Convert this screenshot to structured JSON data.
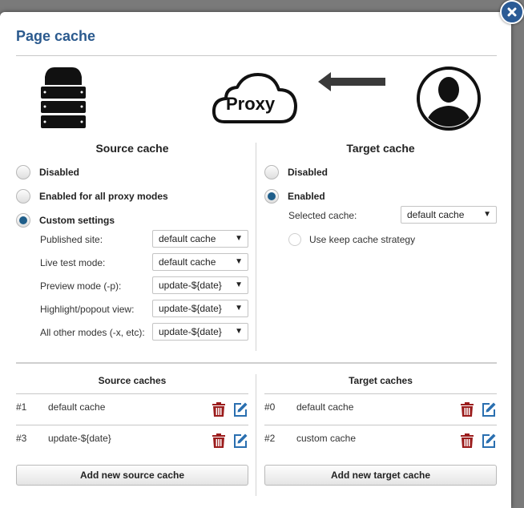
{
  "dialog": {
    "title": "Page cache"
  },
  "diagram": {
    "proxy_label": "Proxy"
  },
  "source": {
    "title": "Source cache",
    "options": [
      "Disabled",
      "Enabled for all proxy modes",
      "Custom settings"
    ],
    "selected": "Custom settings",
    "fields": [
      {
        "label": "Published site:",
        "value": "default cache"
      },
      {
        "label": "Live test mode:",
        "value": "default cache"
      },
      {
        "label": "Preview mode (-p):",
        "value": "update-${date}"
      },
      {
        "label": "Highlight/popout view:",
        "value": "update-${date}"
      },
      {
        "label": "All other modes (-x, etc):",
        "value": "update-${date}"
      }
    ]
  },
  "target": {
    "title": "Target cache",
    "options": [
      "Disabled",
      "Enabled"
    ],
    "selected": "Enabled",
    "selected_cache_label": "Selected cache:",
    "selected_cache_value": "default cache",
    "keep_strategy_label": "Use keep cache strategy"
  },
  "source_caches": {
    "title": "Source caches",
    "rows": [
      {
        "id": "#1",
        "name": "default cache"
      },
      {
        "id": "#3",
        "name": "update-${date}"
      }
    ],
    "add_label": "Add new source cache"
  },
  "target_caches": {
    "title": "Target caches",
    "rows": [
      {
        "id": "#0",
        "name": "default cache"
      },
      {
        "id": "#2",
        "name": "custom cache"
      }
    ],
    "add_label": "Add new target cache"
  },
  "icons": {
    "close": "close-icon",
    "server": "server-icon",
    "proxy": "proxy-cloud-icon",
    "arrow": "arrow-left-icon",
    "user": "user-icon",
    "delete": "trash-icon",
    "edit": "edit-icon"
  },
  "colors": {
    "title": "#2b5a8e",
    "radio_checked": "#1f5e8a",
    "delete_icon": "#9b1c1c",
    "edit_icon": "#2a6fb0"
  }
}
